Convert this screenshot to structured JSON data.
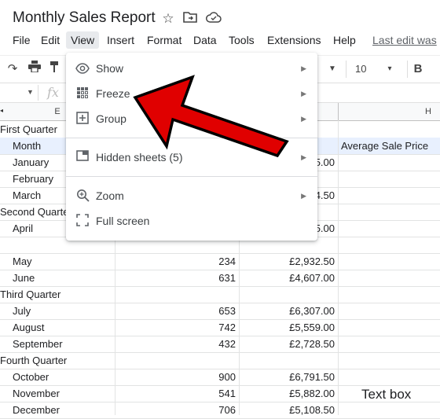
{
  "doc": {
    "title": "Monthly Sales Report"
  },
  "menu": [
    "File",
    "Edit",
    "View",
    "Insert",
    "Format",
    "Data",
    "Tools",
    "Extensions",
    "Help"
  ],
  "last_edit": "Last edit was",
  "toolbar": {
    "font_size": "10",
    "bold": "B"
  },
  "columns": {
    "e": "E",
    "h": "H"
  },
  "sheet": {
    "rows": [
      {
        "label": "First Quarter",
        "indent": false,
        "b": "",
        "c": "",
        "d": ""
      },
      {
        "label": "Month",
        "indent": true,
        "b": "",
        "c": "",
        "d": "Average Sale Price",
        "selected": true
      },
      {
        "label": "January",
        "indent": true,
        "b": "",
        "c": "5.00",
        "d": ""
      },
      {
        "label": "February",
        "indent": true,
        "b": "",
        "c": "",
        "d": ""
      },
      {
        "label": "March",
        "indent": true,
        "b": "",
        "c": "4.50",
        "d": ""
      },
      {
        "label": "Second Quarter",
        "indent": false,
        "b": "",
        "c": "",
        "d": ""
      },
      {
        "label": "April",
        "indent": true,
        "b": "",
        "c": "5.00",
        "d": ""
      },
      {
        "label": "",
        "indent": true,
        "b": "",
        "c": "",
        "d": ""
      },
      {
        "label": "May",
        "indent": true,
        "b": "234",
        "c": "£2,932.50",
        "d": ""
      },
      {
        "label": "June",
        "indent": true,
        "b": "631",
        "c": "£4,607.00",
        "d": ""
      },
      {
        "label": "Third Quarter",
        "indent": false,
        "b": "",
        "c": "",
        "d": ""
      },
      {
        "label": "July",
        "indent": true,
        "b": "653",
        "c": "£6,307.00",
        "d": ""
      },
      {
        "label": "August",
        "indent": true,
        "b": "742",
        "c": "£5,559.00",
        "d": ""
      },
      {
        "label": "September",
        "indent": true,
        "b": "432",
        "c": "£2,728.50",
        "d": ""
      },
      {
        "label": "Fourth Quarter",
        "indent": false,
        "b": "",
        "c": "",
        "d": ""
      },
      {
        "label": "October",
        "indent": true,
        "b": "900",
        "c": "£6,791.50",
        "d": ""
      },
      {
        "label": "November",
        "indent": true,
        "b": "541",
        "c": "£5,882.00",
        "d": ""
      },
      {
        "label": "December",
        "indent": true,
        "b": "706",
        "c": "£5,108.50",
        "d": ""
      }
    ]
  },
  "view_menu": {
    "items": [
      {
        "label": "Show",
        "icon": "eye-icon"
      },
      {
        "label": "Freeze",
        "icon": "freeze-grid-icon"
      },
      {
        "label": "Group",
        "icon": "plus-box-icon"
      },
      {
        "label": "Hidden sheets (5)",
        "icon": "hidden-sheet-icon"
      },
      {
        "label": "Zoom",
        "icon": "zoom-icon"
      },
      {
        "label": "Full screen",
        "icon": "fullscreen-icon"
      }
    ]
  },
  "annotation": {
    "text_box": "Text box",
    "arrow_color": "#e00000"
  }
}
